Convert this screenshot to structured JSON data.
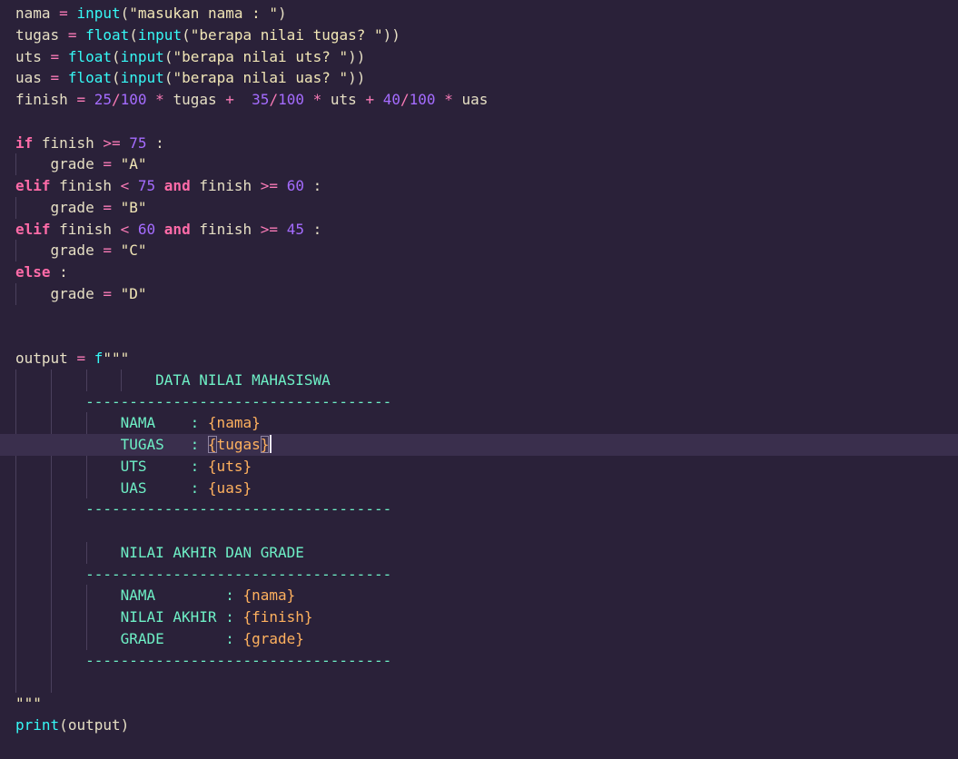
{
  "editor": {
    "lines": [
      [
        {
          "text": "nama",
          "type": "var"
        },
        {
          "text": " ",
          "type": "space"
        },
        {
          "text": "=",
          "type": "op"
        },
        {
          "text": " ",
          "type": "space"
        },
        {
          "text": "input",
          "type": "fn"
        },
        {
          "text": "(",
          "type": "punc"
        },
        {
          "text": "\"masukan nama : \"",
          "type": "str"
        },
        {
          "text": ")",
          "type": "punc"
        }
      ],
      [
        {
          "text": "tugas",
          "type": "var"
        },
        {
          "text": " ",
          "type": "space"
        },
        {
          "text": "=",
          "type": "op"
        },
        {
          "text": " ",
          "type": "space"
        },
        {
          "text": "float",
          "type": "fn"
        },
        {
          "text": "(",
          "type": "punc"
        },
        {
          "text": "input",
          "type": "fn"
        },
        {
          "text": "(",
          "type": "punc"
        },
        {
          "text": "\"berapa nilai tugas? \"",
          "type": "str"
        },
        {
          "text": "))",
          "type": "punc"
        }
      ],
      [
        {
          "text": "uts",
          "type": "var"
        },
        {
          "text": " ",
          "type": "space"
        },
        {
          "text": "=",
          "type": "op"
        },
        {
          "text": " ",
          "type": "space"
        },
        {
          "text": "float",
          "type": "fn"
        },
        {
          "text": "(",
          "type": "punc"
        },
        {
          "text": "input",
          "type": "fn"
        },
        {
          "text": "(",
          "type": "punc"
        },
        {
          "text": "\"berapa nilai uts? \"",
          "type": "str"
        },
        {
          "text": "))",
          "type": "punc"
        }
      ],
      [
        {
          "text": "uas",
          "type": "var"
        },
        {
          "text": " ",
          "type": "space"
        },
        {
          "text": "=",
          "type": "op"
        },
        {
          "text": " ",
          "type": "space"
        },
        {
          "text": "float",
          "type": "fn"
        },
        {
          "text": "(",
          "type": "punc"
        },
        {
          "text": "input",
          "type": "fn"
        },
        {
          "text": "(",
          "type": "punc"
        },
        {
          "text": "\"berapa nilai uas? \"",
          "type": "str"
        },
        {
          "text": "))",
          "type": "punc"
        }
      ],
      [
        {
          "text": "finish",
          "type": "var"
        },
        {
          "text": " ",
          "type": "space"
        },
        {
          "text": "=",
          "type": "op"
        },
        {
          "text": " ",
          "type": "space"
        },
        {
          "text": "25",
          "type": "num"
        },
        {
          "text": "/",
          "type": "op"
        },
        {
          "text": "100",
          "type": "num"
        },
        {
          "text": " ",
          "type": "space"
        },
        {
          "text": "*",
          "type": "op"
        },
        {
          "text": " ",
          "type": "space"
        },
        {
          "text": "tugas",
          "type": "var"
        },
        {
          "text": " ",
          "type": "space"
        },
        {
          "text": "+",
          "type": "op"
        },
        {
          "text": "  ",
          "type": "space"
        },
        {
          "text": "35",
          "type": "num"
        },
        {
          "text": "/",
          "type": "op"
        },
        {
          "text": "100",
          "type": "num"
        },
        {
          "text": " ",
          "type": "space"
        },
        {
          "text": "*",
          "type": "op"
        },
        {
          "text": " ",
          "type": "space"
        },
        {
          "text": "uts",
          "type": "var"
        },
        {
          "text": " ",
          "type": "space"
        },
        {
          "text": "+",
          "type": "op"
        },
        {
          "text": " ",
          "type": "space"
        },
        {
          "text": "40",
          "type": "num"
        },
        {
          "text": "/",
          "type": "op"
        },
        {
          "text": "100",
          "type": "num"
        },
        {
          "text": " ",
          "type": "space"
        },
        {
          "text": "*",
          "type": "op"
        },
        {
          "text": " ",
          "type": "space"
        },
        {
          "text": "uas",
          "type": "var"
        }
      ],
      [],
      [
        {
          "text": "if",
          "type": "kw"
        },
        {
          "text": " ",
          "type": "space"
        },
        {
          "text": "finish",
          "type": "var"
        },
        {
          "text": " ",
          "type": "space"
        },
        {
          "text": ">=",
          "type": "op"
        },
        {
          "text": " ",
          "type": "space"
        },
        {
          "text": "75",
          "type": "num"
        },
        {
          "text": " ",
          "type": "space"
        },
        {
          "text": ":",
          "type": "punc"
        }
      ],
      [
        {
          "text": "    ",
          "type": "space"
        },
        {
          "text": "grade",
          "type": "var"
        },
        {
          "text": " ",
          "type": "space"
        },
        {
          "text": "=",
          "type": "op"
        },
        {
          "text": " ",
          "type": "space"
        },
        {
          "text": "\"A\"",
          "type": "str"
        }
      ],
      [
        {
          "text": "elif",
          "type": "kw"
        },
        {
          "text": " ",
          "type": "space"
        },
        {
          "text": "finish",
          "type": "var"
        },
        {
          "text": " ",
          "type": "space"
        },
        {
          "text": "<",
          "type": "op"
        },
        {
          "text": " ",
          "type": "space"
        },
        {
          "text": "75",
          "type": "num"
        },
        {
          "text": " ",
          "type": "space"
        },
        {
          "text": "and",
          "type": "kw"
        },
        {
          "text": " ",
          "type": "space"
        },
        {
          "text": "finish",
          "type": "var"
        },
        {
          "text": " ",
          "type": "space"
        },
        {
          "text": ">=",
          "type": "op"
        },
        {
          "text": " ",
          "type": "space"
        },
        {
          "text": "60",
          "type": "num"
        },
        {
          "text": " ",
          "type": "space"
        },
        {
          "text": ":",
          "type": "punc"
        }
      ],
      [
        {
          "text": "    ",
          "type": "space"
        },
        {
          "text": "grade",
          "type": "var"
        },
        {
          "text": " ",
          "type": "space"
        },
        {
          "text": "=",
          "type": "op"
        },
        {
          "text": " ",
          "type": "space"
        },
        {
          "text": "\"B\"",
          "type": "str"
        }
      ],
      [
        {
          "text": "elif",
          "type": "kw"
        },
        {
          "text": " ",
          "type": "space"
        },
        {
          "text": "finish",
          "type": "var"
        },
        {
          "text": " ",
          "type": "space"
        },
        {
          "text": "<",
          "type": "op"
        },
        {
          "text": " ",
          "type": "space"
        },
        {
          "text": "60",
          "type": "num"
        },
        {
          "text": " ",
          "type": "space"
        },
        {
          "text": "and",
          "type": "kw"
        },
        {
          "text": " ",
          "type": "space"
        },
        {
          "text": "finish",
          "type": "var"
        },
        {
          "text": " ",
          "type": "space"
        },
        {
          "text": ">=",
          "type": "op"
        },
        {
          "text": " ",
          "type": "space"
        },
        {
          "text": "45",
          "type": "num"
        },
        {
          "text": " ",
          "type": "space"
        },
        {
          "text": ":",
          "type": "punc"
        }
      ],
      [
        {
          "text": "    ",
          "type": "space"
        },
        {
          "text": "grade",
          "type": "var"
        },
        {
          "text": " ",
          "type": "space"
        },
        {
          "text": "=",
          "type": "op"
        },
        {
          "text": " ",
          "type": "space"
        },
        {
          "text": "\"C\"",
          "type": "str"
        }
      ],
      [
        {
          "text": "else",
          "type": "kw"
        },
        {
          "text": " ",
          "type": "space"
        },
        {
          "text": ":",
          "type": "punc"
        }
      ],
      [
        {
          "text": "    ",
          "type": "space"
        },
        {
          "text": "grade",
          "type": "var"
        },
        {
          "text": " ",
          "type": "space"
        },
        {
          "text": "=",
          "type": "op"
        },
        {
          "text": " ",
          "type": "space"
        },
        {
          "text": "\"D\"",
          "type": "str"
        }
      ],
      [],
      [],
      [
        {
          "text": "output",
          "type": "var"
        },
        {
          "text": " ",
          "type": "space"
        },
        {
          "text": "=",
          "type": "op"
        },
        {
          "text": " ",
          "type": "space"
        },
        {
          "text": "f",
          "type": "fn"
        },
        {
          "text": "\"\"\"",
          "type": "str"
        }
      ],
      [
        {
          "text": "                DATA NILAI MAHASISWA",
          "type": "fstr"
        }
      ],
      [
        {
          "text": "        -----------------------------------",
          "type": "fstr"
        }
      ],
      [
        {
          "text": "            NAMA    : ",
          "type": "fstr"
        },
        {
          "text": "{nama}",
          "type": "interp"
        }
      ],
      [
        {
          "text": "            TUGAS   : ",
          "type": "fstr"
        },
        {
          "text": "{",
          "type": "interp-box"
        },
        {
          "text": "tugas",
          "type": "interp"
        },
        {
          "text": "}",
          "type": "interp-box"
        }
      ],
      [
        {
          "text": "            UTS     : ",
          "type": "fstr"
        },
        {
          "text": "{uts}",
          "type": "interp"
        }
      ],
      [
        {
          "text": "            UAS     : ",
          "type": "fstr"
        },
        {
          "text": "{uas}",
          "type": "interp"
        }
      ],
      [
        {
          "text": "        -----------------------------------",
          "type": "fstr"
        }
      ],
      [],
      [
        {
          "text": "            NILAI AKHIR DAN GRADE",
          "type": "fstr"
        }
      ],
      [
        {
          "text": "        -----------------------------------",
          "type": "fstr"
        }
      ],
      [
        {
          "text": "            NAMA        : ",
          "type": "fstr"
        },
        {
          "text": "{nama}",
          "type": "interp"
        }
      ],
      [
        {
          "text": "            NILAI AKHIR : ",
          "type": "fstr"
        },
        {
          "text": "{finish}",
          "type": "interp"
        }
      ],
      [
        {
          "text": "            GRADE       : ",
          "type": "fstr"
        },
        {
          "text": "{grade}",
          "type": "interp"
        }
      ],
      [
        {
          "text": "        -----------------------------------",
          "type": "fstr"
        }
      ],
      [],
      [
        {
          "text": "\"\"\"",
          "type": "str"
        }
      ],
      [
        {
          "text": "print",
          "type": "fn"
        },
        {
          "text": "(",
          "type": "punc"
        },
        {
          "text": "output",
          "type": "var"
        },
        {
          "text": ")",
          "type": "punc"
        }
      ]
    ],
    "active_line_index": 20,
    "colors": {
      "background": "#2a2139",
      "active_line": "#3a2f4d",
      "variable": "#e6dfc4",
      "operator": "#f97ab6",
      "function": "#36f9f6",
      "string": "#f1e6b6",
      "number": "#a56cff",
      "keyword": "#ff6ba8",
      "fstring_text": "#6ef0c6",
      "interpolation": "#ffb15e"
    }
  }
}
